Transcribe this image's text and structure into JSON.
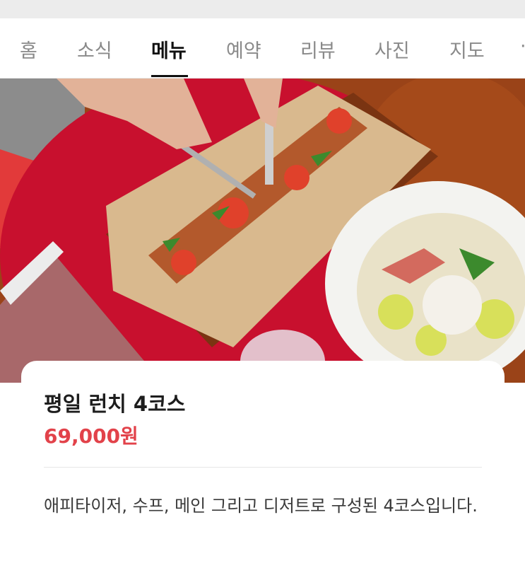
{
  "tabs": [
    "홈",
    "소식",
    "메뉴",
    "예약",
    "리뷰",
    "사진",
    "지도"
  ],
  "active_tab": "메뉴",
  "menu_item": {
    "title": "평일 런치 4코스",
    "price": "69,000원",
    "description": "애피타이저, 수프, 메인 그리고 디저트로 구성된 4코스입니다."
  },
  "colors": {
    "price": "#e2424a",
    "table_red": "#c8102e",
    "wood": "#8a3b14"
  },
  "photo_subject": "food-photo"
}
